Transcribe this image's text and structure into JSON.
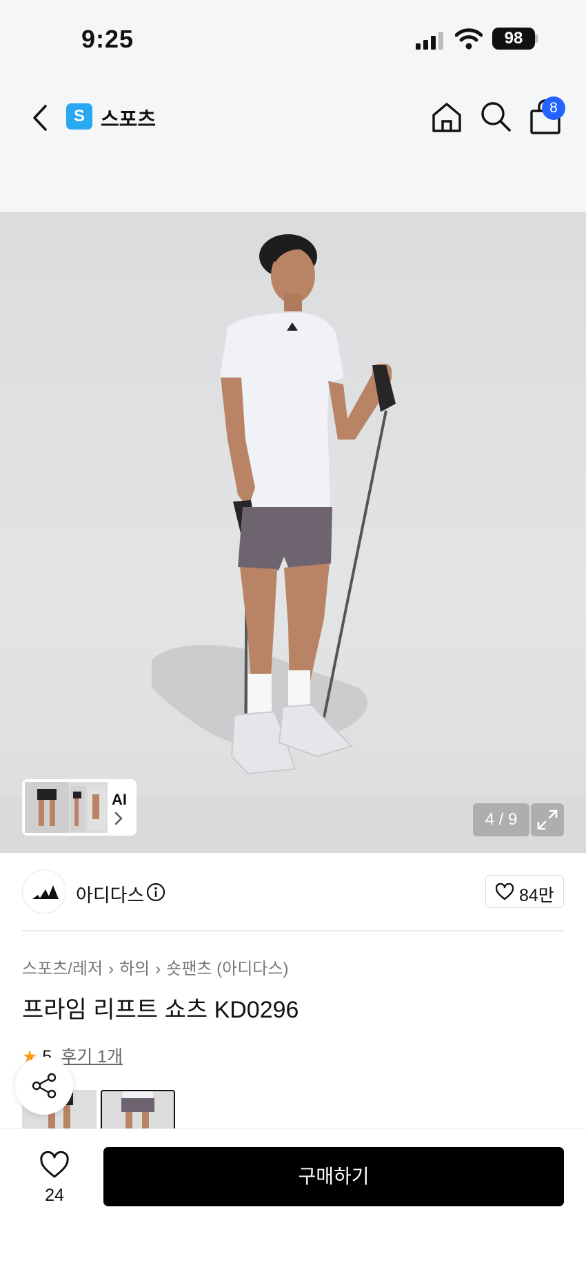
{
  "status_bar": {
    "time": "9:25",
    "battery": "98"
  },
  "nav": {
    "service_logo_letter": "S",
    "service_name": "스포츠",
    "cart_count": "8"
  },
  "gallery": {
    "ai_label": "AI",
    "page_indicator": "4 / 9"
  },
  "brand": {
    "name": "아디다스",
    "likes": "84만"
  },
  "breadcrumb": [
    "스포츠/레저",
    "하의",
    "숏팬츠 (아디다스)"
  ],
  "product": {
    "title": "프라임 리프트 쇼츠 KD0296",
    "rating": "5",
    "review_text": "후기 1개"
  },
  "bottom_bar": {
    "wish_count": "24",
    "buy_label": "구매하기"
  },
  "colors": {
    "accent_blue": "#2563ff",
    "service_blue": "#2aa8f2",
    "star": "#ff9b0f"
  }
}
